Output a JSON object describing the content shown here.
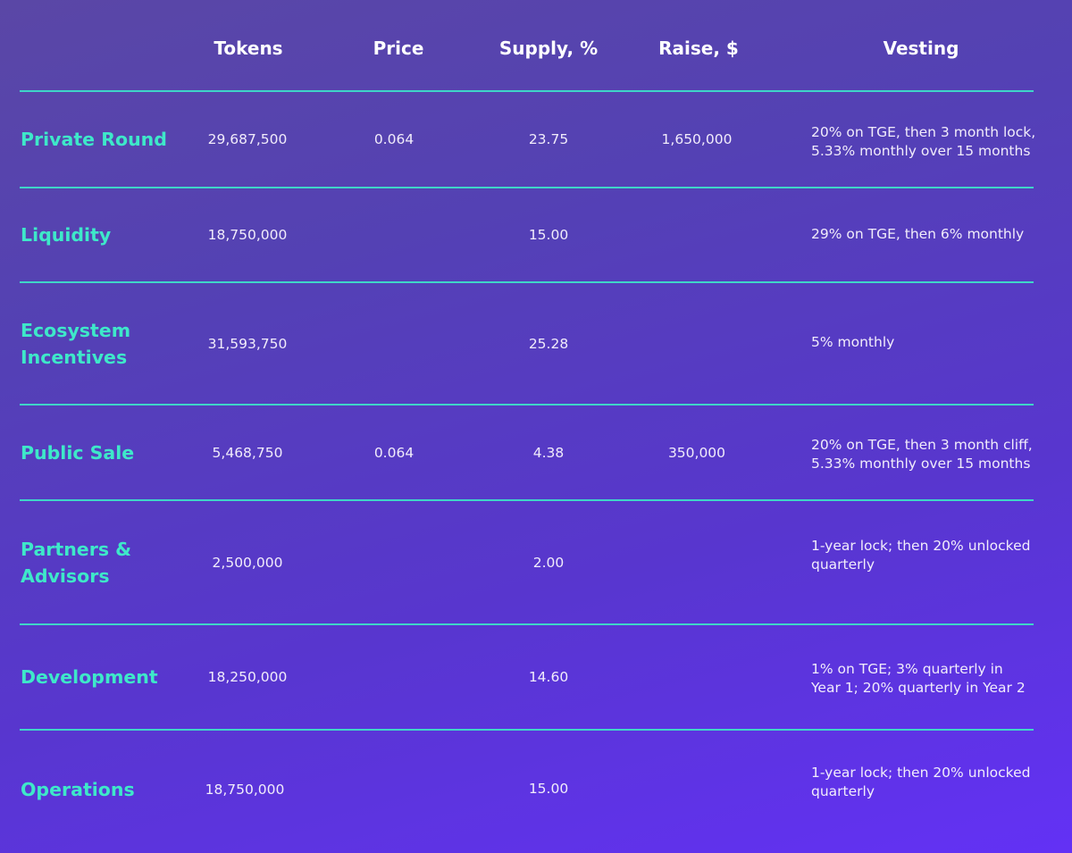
{
  "headers": {
    "tokens": "Tokens",
    "price": "Price",
    "supply": "Supply, %",
    "raise": "Raise, $",
    "vesting": "Vesting"
  },
  "rows": [
    {
      "name": "Private Round",
      "tokens": "29,687,500",
      "price": "0.064",
      "supply": "23.75",
      "raise": "1,650,000",
      "vesting_line1": "20% on TGE, then 3 month lock,",
      "vesting_line2": "5.33% monthly over 15 months"
    },
    {
      "name": "Liquidity",
      "tokens": "18,750,000",
      "price": "",
      "supply": "15.00",
      "raise": "",
      "vesting_line1": "29% on TGE, then 6% monthly",
      "vesting_line2": ""
    },
    {
      "name_line1": "Ecosystem",
      "name_line2": "Incentives",
      "tokens": "31,593,750",
      "price": "",
      "supply": "25.28",
      "raise": "",
      "vesting_line1": "5% monthly",
      "vesting_line2": ""
    },
    {
      "name": "Public Sale",
      "tokens": "5,468,750",
      "price": "0.064",
      "supply": "4.38",
      "raise": "350,000",
      "vesting_line1": "20% on TGE, then 3 month cliff,",
      "vesting_line2": "5.33% monthly over 15 months"
    },
    {
      "name_line1": "Partners &",
      "name_line2": "Advisors",
      "tokens": "2,500,000",
      "price": "",
      "supply": "2.00",
      "raise": "",
      "vesting_line1": "1-year lock; then 20% unlocked",
      "vesting_line2": "quarterly"
    },
    {
      "name": "Development",
      "tokens": "18,250,000",
      "price": "",
      "supply": "14.60",
      "raise": "",
      "vesting_line1": "1% on TGE; 3% quarterly in",
      "vesting_line2": "Year 1; 20% quarterly in Year 2"
    },
    {
      "name": "Operations",
      "tokens": "18,750,000",
      "price": "",
      "supply": "15.00",
      "raise": "",
      "vesting_line1": "1-year lock; then 20% unlocked",
      "vesting_line2": "quarterly"
    }
  ],
  "colors": {
    "accent": "#3ee8c9",
    "rule": "#3fd5c8",
    "text": "#f1ecfb"
  }
}
